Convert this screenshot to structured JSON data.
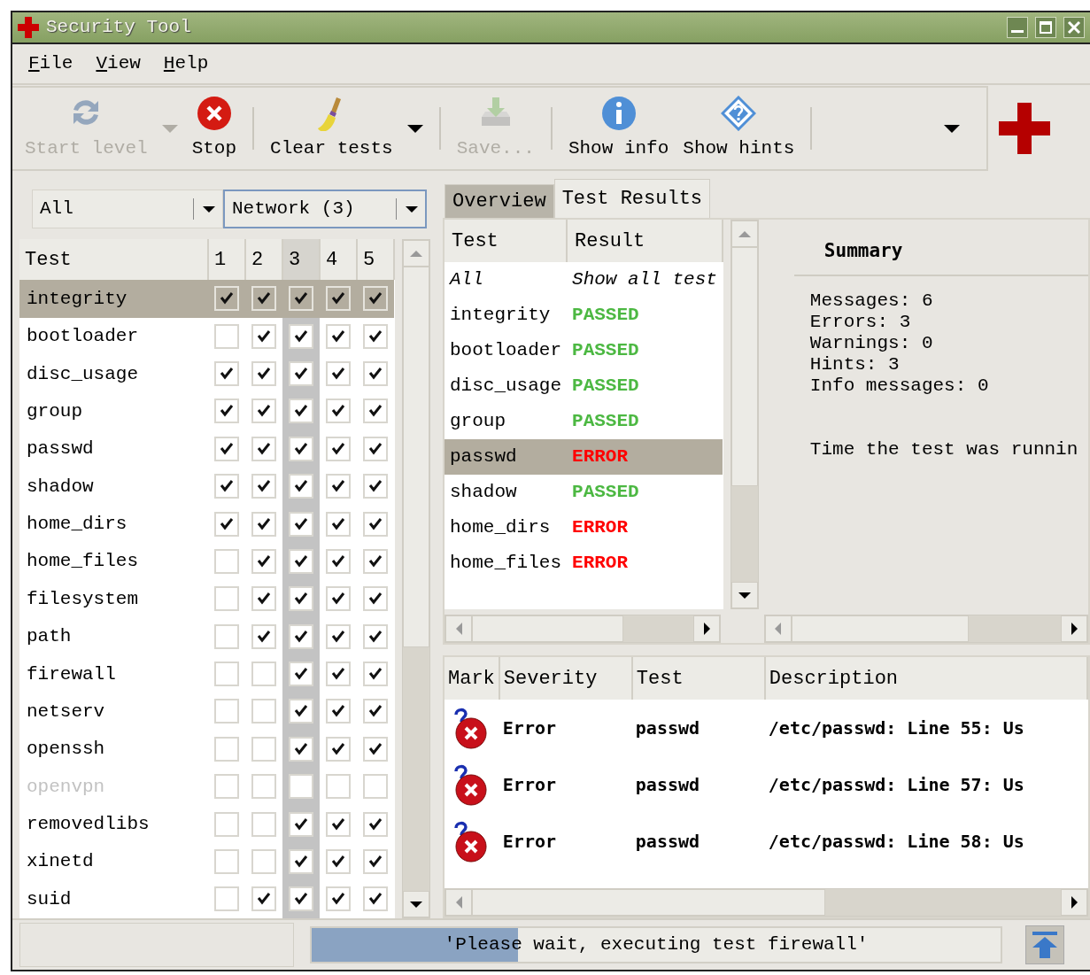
{
  "window": {
    "title": "Security Tool"
  },
  "menu": [
    {
      "label": "File"
    },
    {
      "label": "View"
    },
    {
      "label": "Help"
    }
  ],
  "toolbar": [
    {
      "kind": "button",
      "label": "Start level",
      "disabled": true,
      "menu_arrow": true
    },
    {
      "kind": "button",
      "label": "Stop",
      "disabled": false,
      "menu_arrow": false
    },
    {
      "kind": "separator"
    },
    {
      "kind": "button",
      "label": "Clear tests",
      "disabled": false,
      "menu_arrow": true
    },
    {
      "kind": "separator"
    },
    {
      "kind": "button",
      "label": "Save...",
      "disabled": true,
      "menu_arrow": false
    },
    {
      "kind": "separator"
    },
    {
      "kind": "button",
      "label": "Show info",
      "disabled": false,
      "menu_arrow": false
    },
    {
      "kind": "button",
      "label": "Show hints",
      "disabled": false,
      "menu_arrow": false
    },
    {
      "kind": "separator"
    },
    {
      "kind": "overflow"
    }
  ],
  "filters": [
    {
      "value": "All",
      "focused": false
    },
    {
      "value": "Network (3)",
      "focused": true
    }
  ],
  "tests": {
    "columns": [
      {
        "label": "Test",
        "selected": false
      },
      {
        "label": "1",
        "selected": false
      },
      {
        "label": "2",
        "selected": false
      },
      {
        "label": "3",
        "selected": true
      },
      {
        "label": "4",
        "selected": false
      },
      {
        "label": "5",
        "selected": false
      }
    ],
    "rows": [
      {
        "name": "integrity",
        "selected": true,
        "disabled": false,
        "checks": [
          true,
          true,
          true,
          true,
          true
        ]
      },
      {
        "name": "bootloader",
        "selected": false,
        "disabled": false,
        "checks": [
          false,
          true,
          true,
          true,
          true
        ]
      },
      {
        "name": "disc_usage",
        "selected": false,
        "disabled": false,
        "checks": [
          true,
          true,
          true,
          true,
          true
        ]
      },
      {
        "name": "group",
        "selected": false,
        "disabled": false,
        "checks": [
          true,
          true,
          true,
          true,
          true
        ]
      },
      {
        "name": "passwd",
        "selected": false,
        "disabled": false,
        "checks": [
          true,
          true,
          true,
          true,
          true
        ]
      },
      {
        "name": "shadow",
        "selected": false,
        "disabled": false,
        "checks": [
          true,
          true,
          true,
          true,
          true
        ]
      },
      {
        "name": "home_dirs",
        "selected": false,
        "disabled": false,
        "checks": [
          true,
          true,
          true,
          true,
          true
        ]
      },
      {
        "name": "home_files",
        "selected": false,
        "disabled": false,
        "checks": [
          false,
          true,
          true,
          true,
          true
        ]
      },
      {
        "name": "filesystem",
        "selected": false,
        "disabled": false,
        "checks": [
          false,
          true,
          true,
          true,
          true
        ]
      },
      {
        "name": "path",
        "selected": false,
        "disabled": false,
        "checks": [
          false,
          true,
          true,
          true,
          true
        ]
      },
      {
        "name": "firewall",
        "selected": false,
        "disabled": false,
        "checks": [
          false,
          false,
          true,
          true,
          true
        ]
      },
      {
        "name": "netserv",
        "selected": false,
        "disabled": false,
        "checks": [
          false,
          false,
          true,
          true,
          true
        ]
      },
      {
        "name": "openssh",
        "selected": false,
        "disabled": false,
        "checks": [
          false,
          false,
          true,
          true,
          true
        ]
      },
      {
        "name": "openvpn",
        "selected": false,
        "disabled": true,
        "checks": [
          false,
          false,
          false,
          false,
          false
        ]
      },
      {
        "name": "removedlibs",
        "selected": false,
        "disabled": false,
        "checks": [
          false,
          false,
          true,
          true,
          true
        ]
      },
      {
        "name": "xinetd",
        "selected": false,
        "disabled": false,
        "checks": [
          false,
          false,
          true,
          true,
          true
        ]
      },
      {
        "name": "suid",
        "selected": false,
        "disabled": false,
        "checks": [
          false,
          true,
          true,
          true,
          true
        ]
      }
    ]
  },
  "tabs": [
    {
      "label": "Overview",
      "selected": false
    },
    {
      "label": "Test Results",
      "selected": true
    }
  ],
  "results": {
    "columns": [
      "Test",
      "Result"
    ],
    "rows": [
      {
        "kind": "all",
        "test": "All",
        "result": "Show all test",
        "selected": false
      },
      {
        "kind": "passed",
        "test": "integrity",
        "result": "PASSED",
        "selected": false
      },
      {
        "kind": "passed",
        "test": "bootloader",
        "result": "PASSED",
        "selected": false
      },
      {
        "kind": "passed",
        "test": "disc_usage",
        "result": "PASSED",
        "selected": false
      },
      {
        "kind": "passed",
        "test": "group",
        "result": "PASSED",
        "selected": false
      },
      {
        "kind": "error",
        "test": "passwd",
        "result": "ERROR",
        "selected": true
      },
      {
        "kind": "passed",
        "test": "shadow",
        "result": "PASSED",
        "selected": false
      },
      {
        "kind": "error",
        "test": "home_dirs",
        "result": "ERROR",
        "selected": false
      },
      {
        "kind": "error",
        "test": "home_files",
        "result": "ERROR",
        "selected": false
      }
    ]
  },
  "summary": {
    "title": "Summary",
    "lines": [
      "Messages: 6",
      "Errors: 3",
      "Warnings: 0",
      "Hints: 3",
      "Info messages: 0"
    ],
    "time_label": "Time the test was runnin"
  },
  "messages": {
    "columns": [
      "Mark",
      "Severity",
      "Test",
      "Description"
    ],
    "rows": [
      {
        "severity": "Error",
        "test": "passwd",
        "description": "/etc/passwd: Line 55: Us"
      },
      {
        "severity": "Error",
        "test": "passwd",
        "description": "/etc/passwd: Line 57: Us"
      },
      {
        "severity": "Error",
        "test": "passwd",
        "description": "/etc/passwd: Line 58: Us"
      }
    ]
  },
  "status_bar": {
    "progress": {
      "level": 0.3,
      "text": "'Please wait, executing test firewall'"
    }
  }
}
